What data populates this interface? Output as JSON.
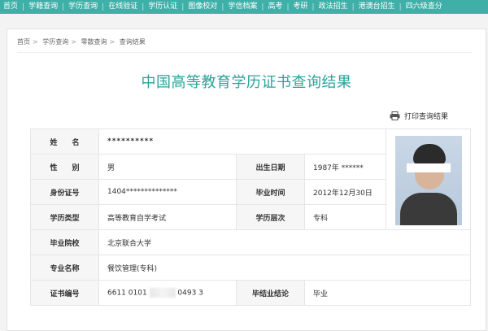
{
  "nav": {
    "items": [
      "首页",
      "学籍查询",
      "学历查询",
      "在线验证",
      "学历认证",
      "图像校对",
      "学信档案",
      "高考",
      "考研",
      "政法招生",
      "港澳台招生",
      "四六级查分"
    ]
  },
  "breadcrumb": [
    "首页",
    "学历查询",
    "零散查询",
    "查询结果"
  ],
  "page_title": "中国高等教育学历证书查询结果",
  "print_label": "打印查询结果",
  "fields": {
    "name": {
      "label": "姓　　名",
      "value": "**********"
    },
    "gender": {
      "label": "性　　别",
      "value": "男"
    },
    "birth": {
      "label": "出生日期",
      "value": "1987年 ******"
    },
    "id_number": {
      "label": "身份证号",
      "value": "1404**************"
    },
    "grad_date": {
      "label": "毕业时间",
      "value": "2012年12月30日"
    },
    "edu_type": {
      "label": "学历类型",
      "value": "高等教育自学考试"
    },
    "edu_level": {
      "label": "学历层次",
      "value": "专科"
    },
    "school": {
      "label": "毕业院校",
      "value": "北京联合大学"
    },
    "major": {
      "label": "专业名称",
      "value": "餐饮管理(专科)"
    },
    "cert_no": {
      "label": "证书编号",
      "value_prefix": "6611 0101",
      "value_suffix": "0493 3"
    },
    "grad_result": {
      "label": "毕结业结论",
      "value": "毕业"
    }
  },
  "colors": {
    "nav_bg": "#3fb0a8",
    "title": "#2aa39b",
    "label_bg": "#f6f6f6"
  },
  "icons": {
    "print": "printer-icon",
    "photo": "photo-portrait"
  }
}
